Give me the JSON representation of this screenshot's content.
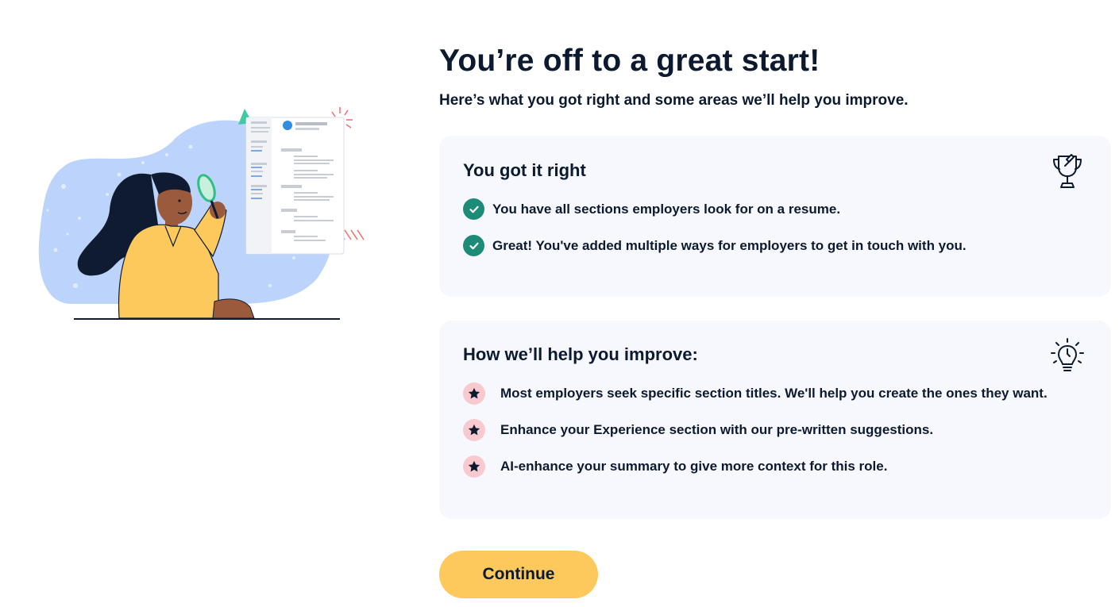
{
  "header": {
    "title": "You’re off to a great start!",
    "subtitle": "Here’s what you got right and some areas we’ll help you improve."
  },
  "got_right": {
    "title": "You got it right",
    "icon": "trophy-icon",
    "items": [
      {
        "icon": "check-icon",
        "text": "You have all sections employers look for on a resume."
      },
      {
        "icon": "check-icon",
        "text": "Great! You've added multiple ways for employers to get in touch with you."
      }
    ]
  },
  "improve": {
    "title": "How we’ll help you improve:",
    "icon": "lightbulb-icon",
    "items": [
      {
        "icon": "star-icon",
        "text": "Most employers seek specific section titles. We'll help you create the ones they want."
      },
      {
        "icon": "star-icon",
        "text": "Enhance your Experience section with our pre-written suggestions."
      },
      {
        "icon": "star-icon",
        "text": "AI-enhance your summary to give more context for this role."
      }
    ]
  },
  "actions": {
    "continue_label": "Continue"
  },
  "colors": {
    "text": "#0c1a2f",
    "card_bg": "#f7f8fd",
    "check_green": "#1c8c78",
    "star_badge": "#f8c9cf",
    "button_yellow": "#fdc85c",
    "blob_blue": "#bcd4fb"
  }
}
